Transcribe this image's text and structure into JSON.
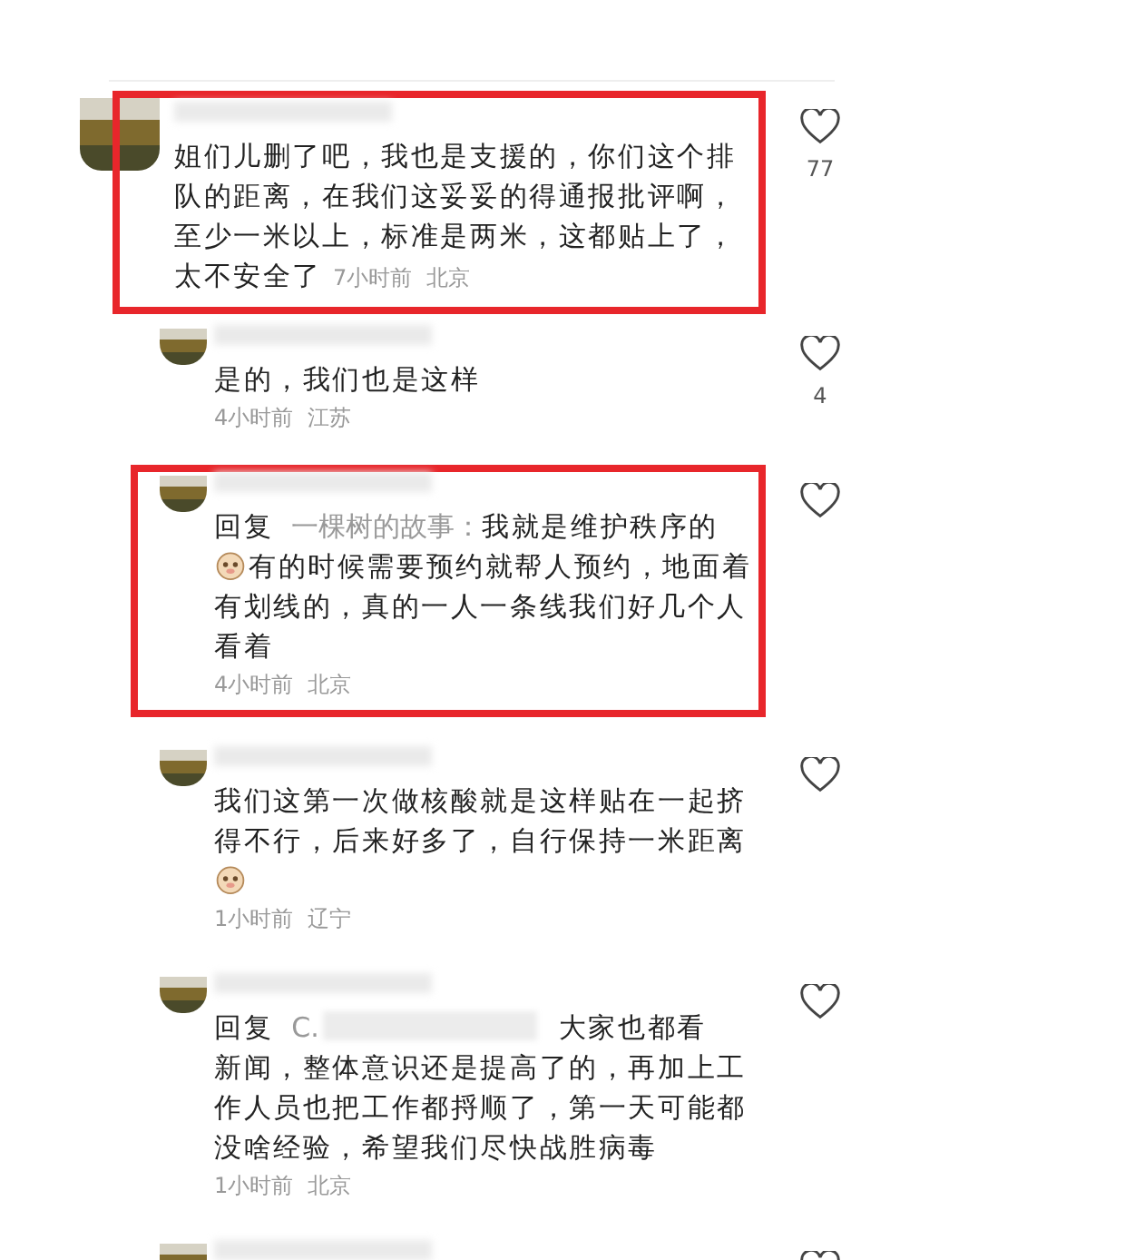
{
  "comments": [
    {
      "kind": "top",
      "highlighted": true,
      "parts": [
        {
          "kind": "text",
          "text": "姐们儿删了吧，我也是支援的，你们这个排队的距离，在我们这妥妥的得通报批评啊，至少一米以上，标准是两米，这都贴上了，"
        },
        {
          "kind": "line",
          "text": "太不安全了"
        }
      ],
      "time": "7小时前",
      "location": "北京",
      "likes": "77"
    },
    {
      "kind": "reply",
      "highlighted": false,
      "parts": [
        {
          "kind": "text",
          "text": "是的，我们也是这样"
        }
      ],
      "time": "4小时前",
      "location": "江苏",
      "likes": "4"
    },
    {
      "kind": "reply",
      "highlighted": true,
      "reply_label": "回复",
      "reply_to": "一棵树的故事：",
      "parts": [
        {
          "kind": "line",
          "text": "我就是维护秩序的"
        },
        {
          "kind": "emoji"
        },
        {
          "kind": "line",
          "text": "有的时候需要预约就帮人预约，地面着"
        },
        {
          "kind": "text",
          "text": "有划线的，真的一人一条线我们好几个人看着"
        }
      ],
      "time": "4小时前",
      "location": "北京"
    },
    {
      "kind": "reply",
      "highlighted": false,
      "parts": [
        {
          "kind": "text",
          "text": "我们这第一次做核酸就是这样贴在一起挤得不行，后来好多了，自行保持一米距离"
        },
        {
          "kind": "emoji"
        }
      ],
      "time": "1小时前",
      "location": "辽宁"
    },
    {
      "kind": "reply",
      "highlighted": false,
      "reply_label": "回复",
      "reply_to": "C.",
      "parts": [
        {
          "kind": "redacted"
        },
        {
          "kind": "line",
          "text": "大家也都看"
        },
        {
          "kind": "text",
          "text": "新闻，整体意识还是提高了的，再加上工作人员也把工作都捋顺了，第一天可能都没啥经验，希望我们尽快战胜病毒"
        }
      ],
      "time": "1小时前",
      "location": "北京"
    },
    {
      "kind": "partial"
    }
  ]
}
